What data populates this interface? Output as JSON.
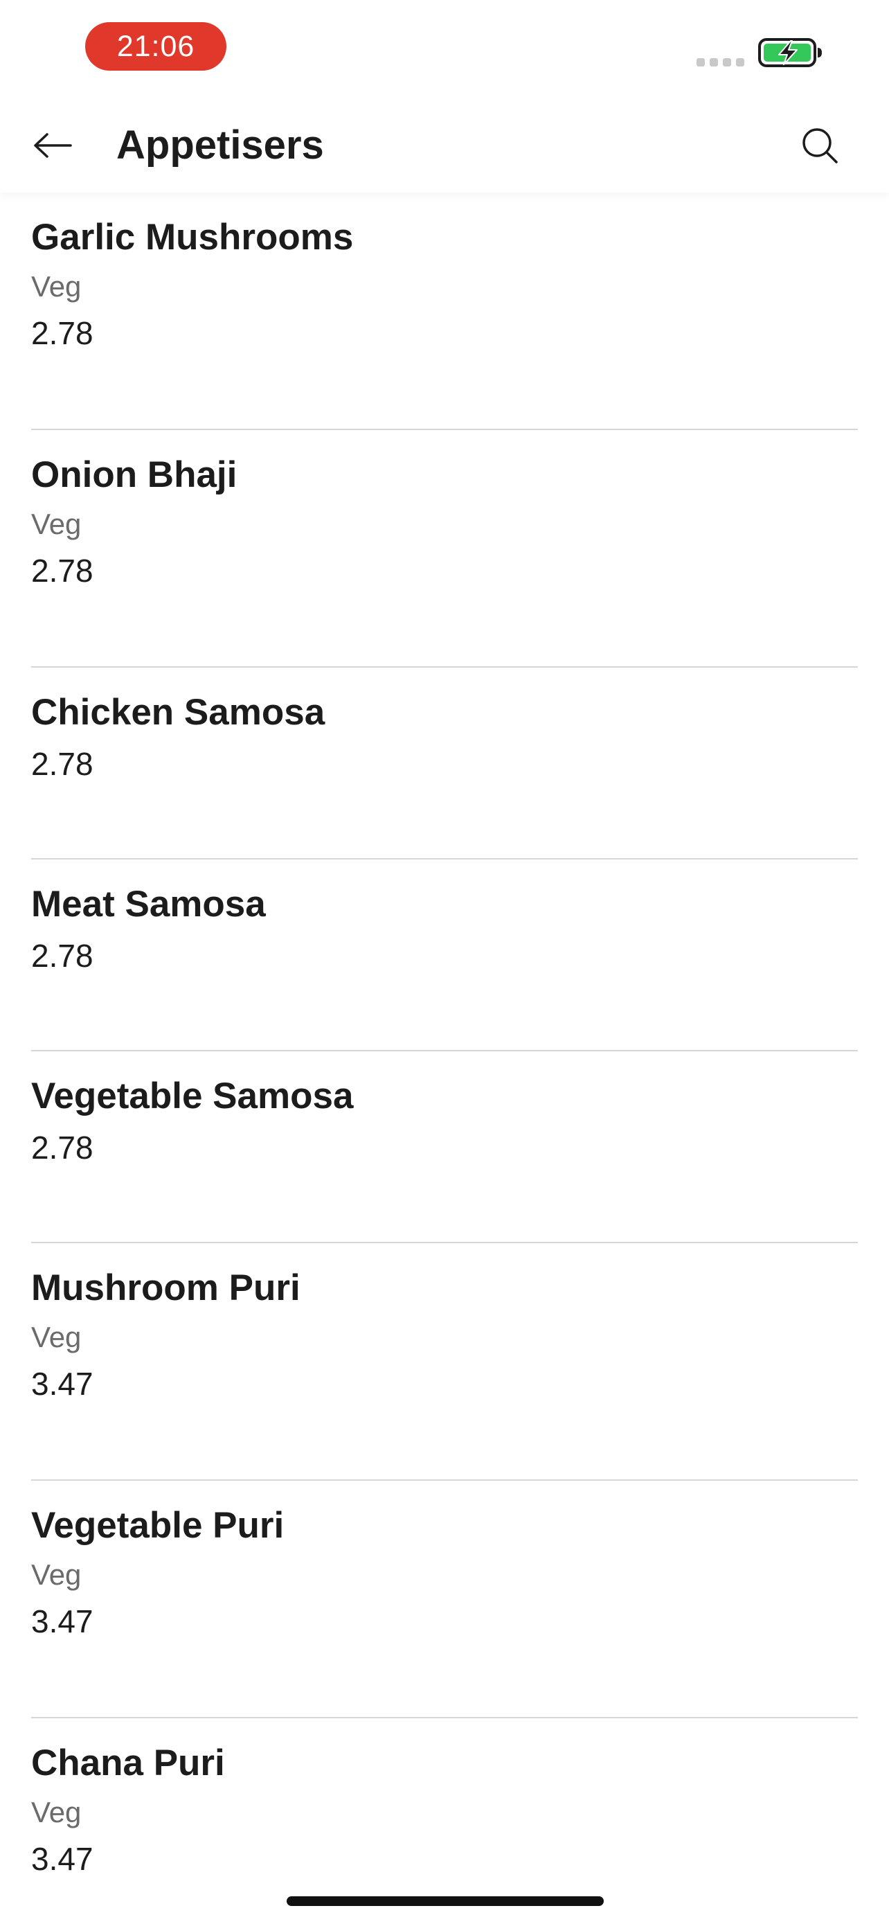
{
  "status_bar": {
    "time": "21:06",
    "time_pill_color": "#e0392b",
    "battery_color": "#34c759",
    "icons": [
      "signal-icon",
      "battery-charging-icon"
    ]
  },
  "header": {
    "title": "Appetisers",
    "back_icon": "arrow-left-icon",
    "search_icon": "search-icon"
  },
  "menu": {
    "items": [
      {
        "name": "Garlic Mushrooms",
        "tag": "Veg",
        "price": "2.78"
      },
      {
        "name": "Onion Bhaji",
        "tag": "Veg",
        "price": "2.78"
      },
      {
        "name": "Chicken Samosa",
        "tag": "",
        "price": "2.78"
      },
      {
        "name": "Meat Samosa",
        "tag": "",
        "price": "2.78"
      },
      {
        "name": "Vegetable Samosa",
        "tag": "",
        "price": "2.78"
      },
      {
        "name": "Mushroom Puri",
        "tag": "Veg",
        "price": "3.47"
      },
      {
        "name": "Vegetable Puri",
        "tag": "Veg",
        "price": "3.47"
      },
      {
        "name": "Chana Puri",
        "tag": "Veg",
        "price": "3.47"
      }
    ]
  }
}
